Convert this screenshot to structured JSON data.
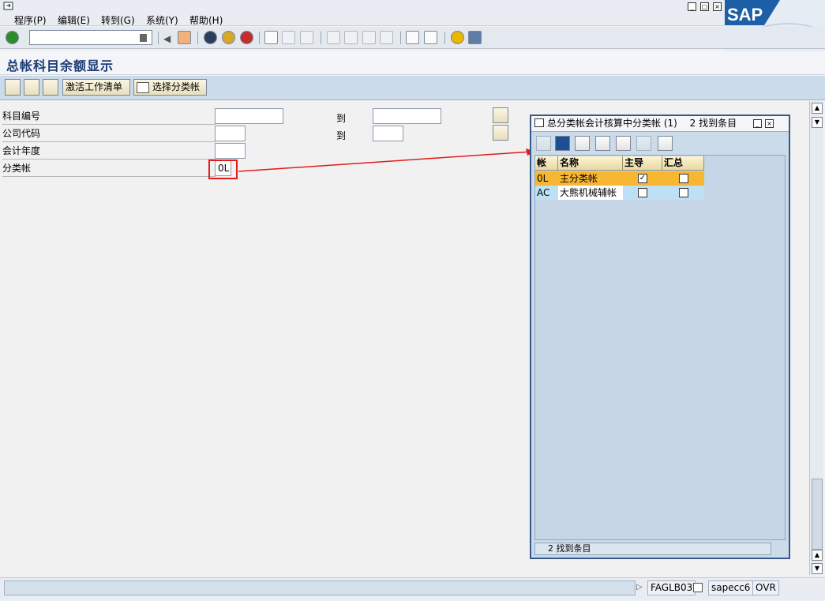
{
  "menu": {
    "items": [
      {
        "label": "程序(P)"
      },
      {
        "label": "编辑(E)"
      },
      {
        "label": "转到(G)"
      },
      {
        "label": "系统(Y)"
      },
      {
        "label": "帮助(H)"
      }
    ]
  },
  "sap_logo": "SAP",
  "title": "总帐科目余额显示",
  "app_toolbar": {
    "activate_worklist": "激活工作清单",
    "choose_ledger": "选择分类帐"
  },
  "form": {
    "gl_account_label": "科目编号",
    "company_code_label": "公司代码",
    "fiscal_year_label": "会计年度",
    "ledger_label": "分类帐",
    "to_label": "到",
    "ledger_value": "0L"
  },
  "popup": {
    "title": "总分类帐会计核算中分类帐 (1)",
    "found_text": "2 找到条目",
    "columns": [
      "帐",
      "名称",
      "主导",
      "汇总"
    ],
    "rows": [
      {
        "code": "0L",
        "name": "主分类帐",
        "leading": true,
        "summary": false
      },
      {
        "code": "AC",
        "name": "大熊机械辅帐",
        "leading": false,
        "summary": false
      }
    ],
    "status": "2 找到条目"
  },
  "statusbar": {
    "transaction": "FAGLB03",
    "system": "sapecc6",
    "mode": "OVR"
  }
}
